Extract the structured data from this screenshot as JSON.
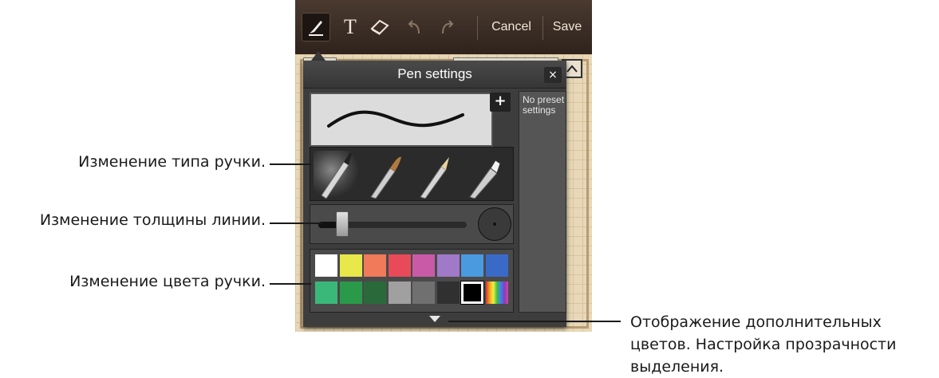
{
  "toolbar": {
    "cancel_label": "Cancel",
    "save_label": "Save"
  },
  "pen_settings": {
    "title": "Pen settings",
    "close_symbol": "×",
    "add_preset_symbol": "+",
    "preset_text": "No preset settings",
    "thickness_value": 0.12,
    "colors_row1": [
      "#ffffff",
      "#e8e84a",
      "#f07a5a",
      "#e84a5a",
      "#c85aa8",
      "#a07ac8",
      "#4a9ae0",
      "#3a6ac8"
    ],
    "colors_row2": [
      "#3ab87a",
      "#2a9a4a",
      "#2a6a3a",
      "#a0a0a0",
      "#707070",
      "#303030",
      "#000000",
      "rainbow"
    ],
    "selected_color_index": 14
  },
  "annotations": {
    "pen_type": "Изменение типа ручки.",
    "thickness": "Изменение толщины линии.",
    "color": "Изменение цвета ручки.",
    "more_line1": "Отображение дополнительных",
    "more_line2": "цветов. Настройка прозрачности",
    "more_line3": "выделения."
  }
}
